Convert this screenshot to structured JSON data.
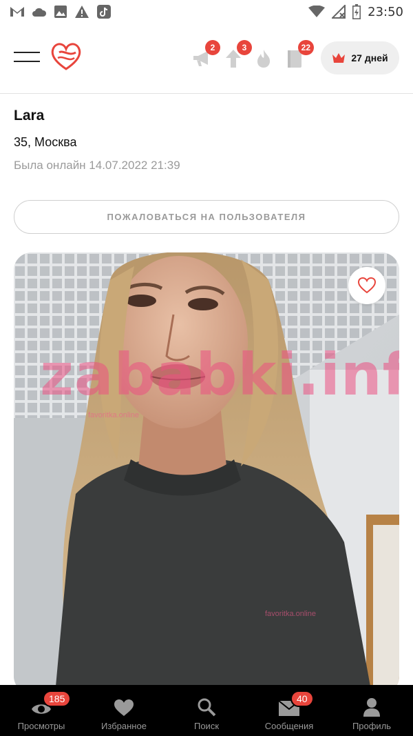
{
  "status_bar": {
    "time": "23:50",
    "icons_left": [
      "gmail-icon",
      "cloud-icon",
      "image-icon",
      "warning-icon",
      "tiktok-icon"
    ],
    "icons_right": [
      "wifi-icon",
      "no-signal-icon",
      "battery-icon"
    ]
  },
  "header": {
    "menu_icon": "hamburger-icon",
    "logo_icon": "heart-logo-icon",
    "icons": [
      {
        "name": "megaphone-icon",
        "badge": "2"
      },
      {
        "name": "boost-up-icon",
        "badge": "3"
      },
      {
        "name": "fire-icon",
        "badge": ""
      },
      {
        "name": "guestbook-icon",
        "badge": "22"
      }
    ],
    "premium": {
      "icon": "crown-icon",
      "label": "27 дней",
      "accent": "#e8453c"
    }
  },
  "profile": {
    "name": "Lara",
    "age_city": "35, Москва",
    "last_seen": "Была онлайн 14.07.2022 21:39",
    "report_button": "ПОЖАЛОВАТЬСЯ НА ПОЛЬЗОВАТЕЛЯ"
  },
  "photo": {
    "favorite_icon": "heart-outline-icon",
    "watermark": "zababki.info",
    "watermark_small_1": "favoritka.online",
    "watermark_small_2": "favoritka.online"
  },
  "bottom_nav": {
    "items": [
      {
        "label": "Просмотры",
        "icon": "eye-icon",
        "badge": "185"
      },
      {
        "label": "Избранное",
        "icon": "heart-icon",
        "badge": ""
      },
      {
        "label": "Поиск",
        "icon": "search-icon",
        "badge": ""
      },
      {
        "label": "Сообщения",
        "icon": "envelope-icon",
        "badge": "40"
      },
      {
        "label": "Профиль",
        "icon": "person-icon",
        "badge": ""
      }
    ]
  },
  "colors": {
    "accent": "#e8453c",
    "nav_bg": "#000000",
    "muted": "#9a9a9a"
  }
}
